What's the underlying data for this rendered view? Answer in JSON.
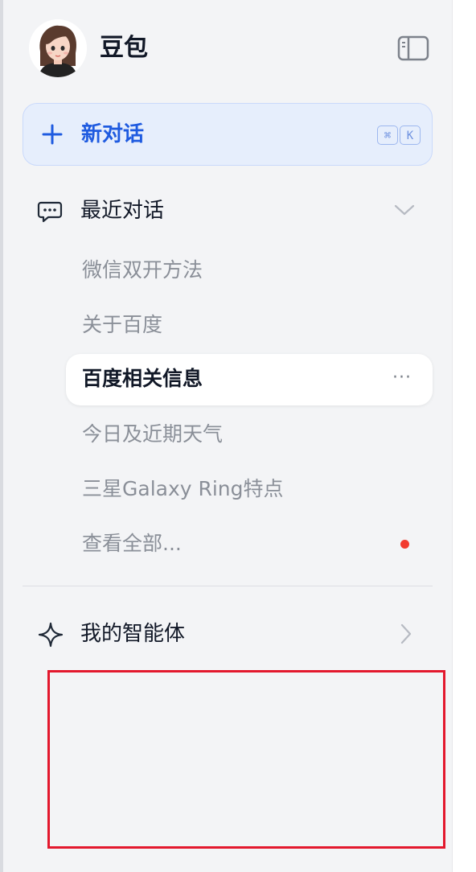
{
  "app": {
    "name": "豆包"
  },
  "new_chat": {
    "label": "新对话",
    "shortcut_cmd": "⌘",
    "shortcut_key": "K"
  },
  "recent": {
    "label": "最近对话",
    "items": [
      {
        "label": "微信双开方法",
        "active": false
      },
      {
        "label": "关于百度",
        "active": false
      },
      {
        "label": "百度相关信息",
        "active": true
      },
      {
        "label": "今日及近期天气",
        "active": false
      },
      {
        "label": "三星Galaxy Ring特点",
        "active": false
      }
    ],
    "view_all": "查看全部...",
    "more_label": "···"
  },
  "agents": {
    "label": "我的智能体"
  },
  "colors": {
    "accent": "#1f5be0",
    "unread_dot": "#f23b2f",
    "highlight_box": "#e3182d"
  }
}
